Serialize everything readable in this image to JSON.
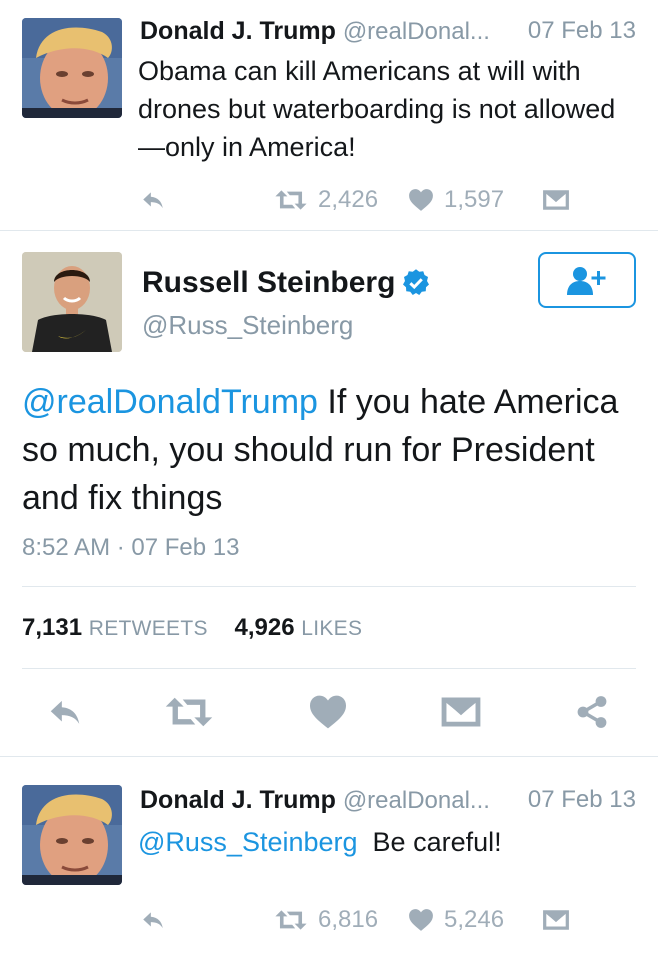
{
  "colors": {
    "accent": "#1b95e0",
    "muted": "#8899a6",
    "icon": "#a0adb8",
    "divider": "#e1e8ed"
  },
  "tweets": [
    {
      "name": "Donald J. Trump",
      "handle": "@realDonal...",
      "time": "07 Feb 13",
      "text": "Obama can kill Americans at will with drones but waterboarding is not allowed—only in America!",
      "retweets": "2,426",
      "likes": "1,597"
    },
    {
      "name": "Donald J. Trump",
      "handle": "@realDonal...",
      "time": "07 Feb 13",
      "mention": "@Russ_Steinberg",
      "text": "Be careful!",
      "retweets": "6,816",
      "likes": "5,246"
    }
  ],
  "expanded": {
    "name": "Russell Steinberg",
    "handle": "@Russ_Steinberg",
    "verified_icon": "verified-badge-icon",
    "follow_icon": "follow-user-plus-icon",
    "mention": "@realDonaldTrump",
    "text": " If you hate America so much, you should run for President and fix things",
    "timestamp": "8:52 AM · 07 Feb 13",
    "retweet_count": "7,131",
    "retweet_label": "RETWEETS",
    "like_count": "4,926",
    "like_label": "LIKES"
  }
}
